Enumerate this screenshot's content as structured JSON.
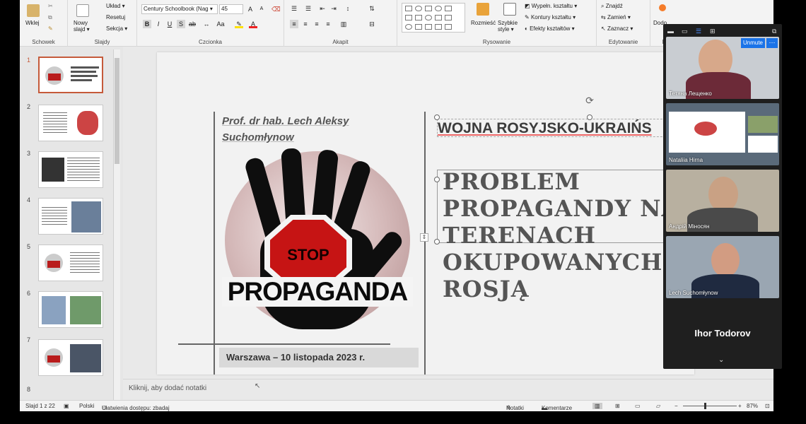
{
  "ribbon": {
    "paste": "Wklej",
    "new_slide": "Nowy slajd ▾",
    "layout": "Układ ▾",
    "reset": "Resetuj",
    "section": "Sekcja ▾",
    "font_name": "Century Schoolbook (Nag ▾",
    "font_size": "45",
    "arrange": "Rozmieść",
    "quick_styles": "Szybkie style ▾",
    "shape_fill": "Wypełn. kształtu ▾",
    "shape_outline": "Kontury kształtu ▾",
    "shape_effects": "Efekty kształtów ▾",
    "find": "Znajdź",
    "replace": "Zamień ▾",
    "select": "Zaznacz ▾",
    "dictate": "Dodo",
    "groups": {
      "clipboard": "Schowek",
      "slides": "Slajdy",
      "font": "Czcionka",
      "paragraph": "Akapit",
      "drawing": "Rysowanie",
      "editing": "Edytowanie",
      "extra": "Dod"
    }
  },
  "thumbnails": [
    "1",
    "2",
    "3",
    "4",
    "5",
    "6",
    "7",
    "8"
  ],
  "slide": {
    "author": "Prof. dr hab. Lech Aleksy Suchomłynow",
    "stop": "STOP",
    "propaganda": "PROPAGANDA",
    "place_date": "Warszawa – 10 listopada 2023 r.",
    "heading": "WOJNA ROSYJSKO-UKRAIŃS",
    "title": "PROBLEM PROPAGANDY NA TERENACH OKUPOWANYCH ROSJĄ"
  },
  "notes_placeholder": "Kliknij, aby dodać notatki",
  "status": {
    "slide_count": "Slajd 1 z 22",
    "language": "Polski",
    "accessibility": "Ułatwienia dostępu: zbadaj",
    "notes": "Notatki",
    "comments": "Komentarze",
    "zoom_percent": "87%"
  },
  "zoom_panel": {
    "unmute": "Unmute",
    "participants": [
      "Тетяна Лещенко",
      "Nataliia Hirna",
      "Андрій Міносян",
      "Lech Suchomłynow",
      "Ihor Todorov"
    ]
  }
}
